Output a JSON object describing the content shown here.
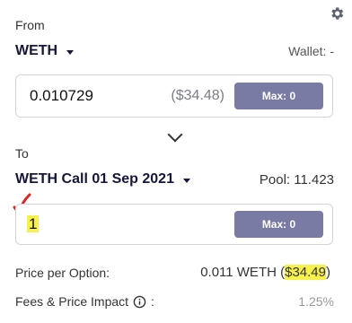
{
  "from": {
    "label": "From",
    "token": "WETH",
    "wallet": "Wallet: -",
    "amount": "0.010729",
    "usd": "($34.48)",
    "max_label": "Max: 0"
  },
  "to": {
    "label": "To",
    "token": "WETH Call 01 Sep 2021",
    "pool": "Pool: 11.423",
    "amount": "1",
    "max_label": "Max: 0"
  },
  "price": {
    "label": "Price per Option:",
    "value_prefix": "0.011 WETH (",
    "value_usd": "$34.49",
    "value_suffix": ")"
  },
  "fees": {
    "label": "Fees & Price Impact",
    "colon": ":",
    "value": "1.25%"
  },
  "icons": {
    "settings": "gear-icon",
    "swap": "chevron-down-icon",
    "info": "info-icon",
    "annotation": "red-arrow-icon"
  },
  "colors": {
    "accent_button": "#7a7ba5",
    "token_text": "#14163a",
    "highlight": "#f7f14a",
    "annotation": "#e0231c"
  }
}
